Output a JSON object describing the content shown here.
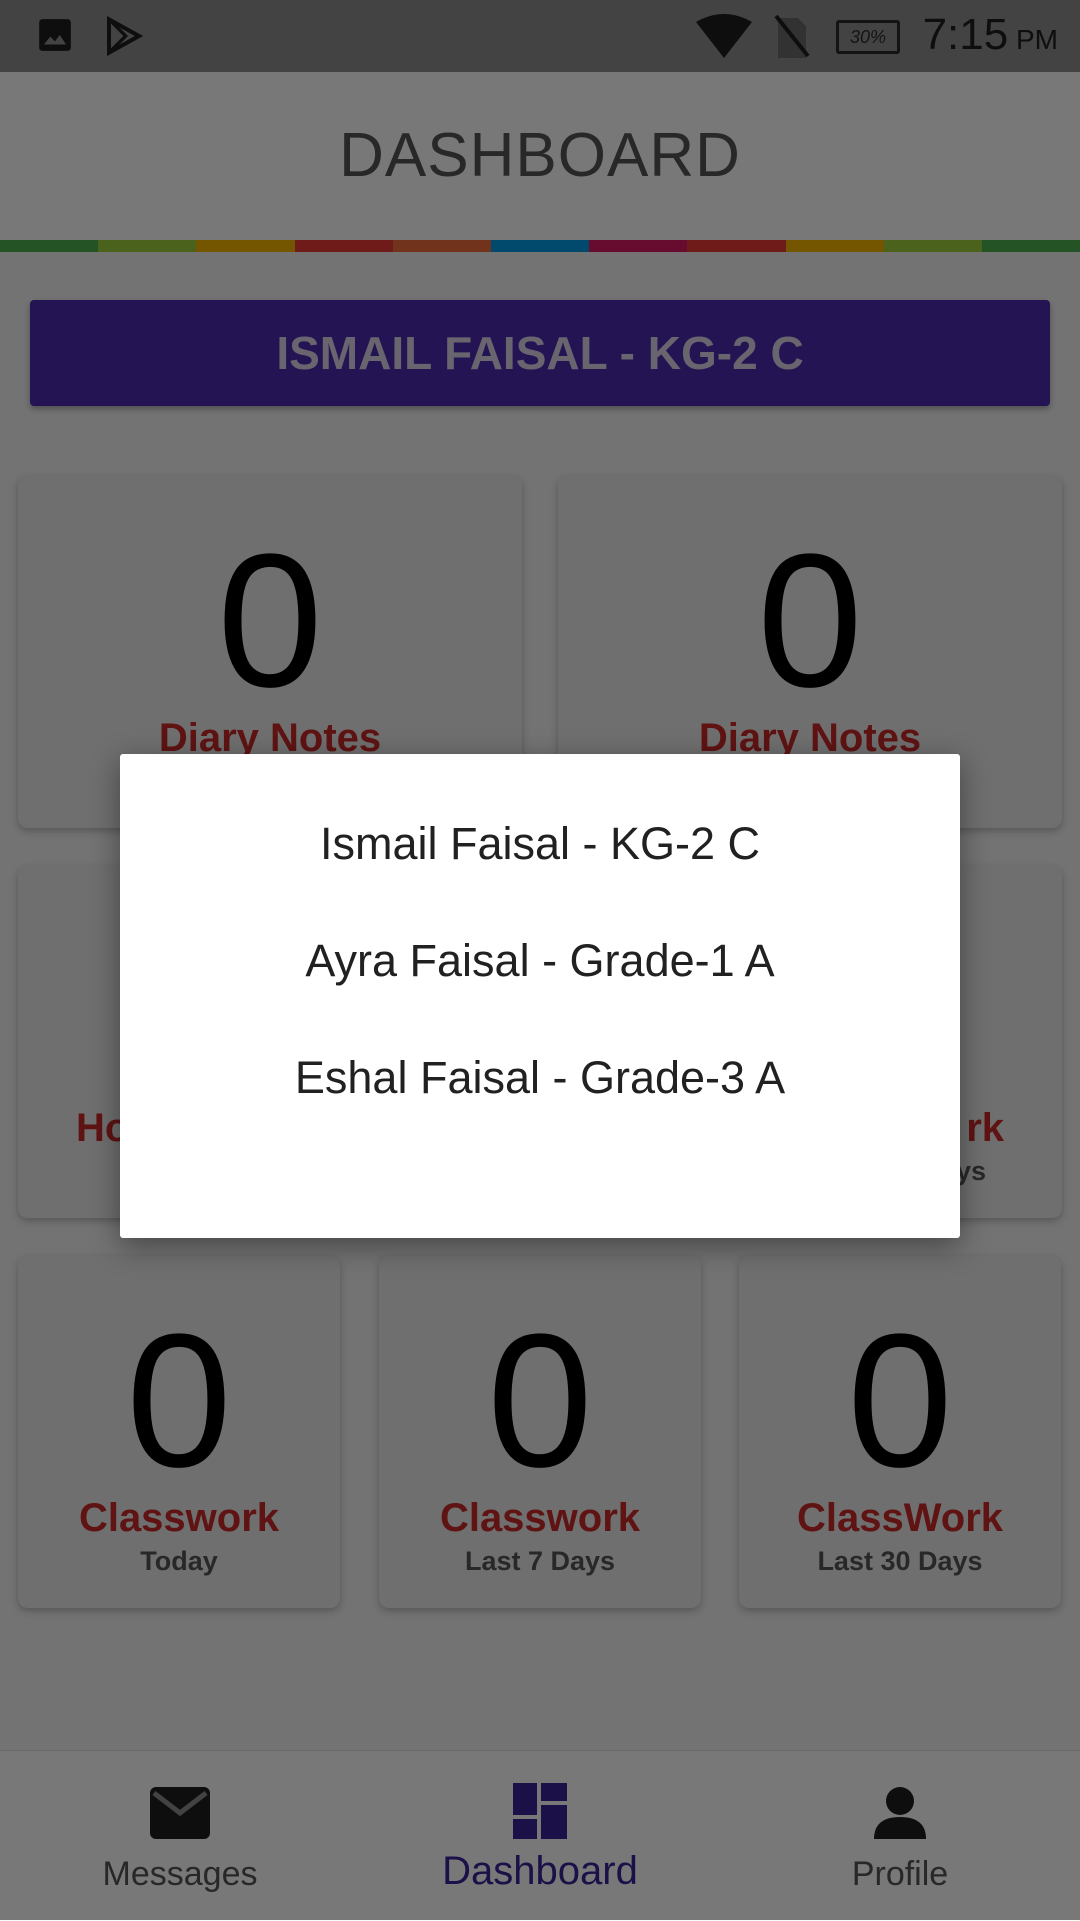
{
  "status_bar": {
    "left_icons": [
      "image-icon",
      "play-store-icon"
    ],
    "right_icons": [
      "wifi-icon",
      "no-sim-icon",
      "battery-icon"
    ],
    "battery": "30%",
    "time": "7:15",
    "ampm": "PM"
  },
  "app_bar": {
    "title": "DASHBOARD"
  },
  "stripe_colors": [
    "#4caf50",
    "#9ccc3c",
    "#f4b400",
    "#e53935",
    "#ef6c3c",
    "#039be5",
    "#d81b60",
    "#e53935",
    "#f4b400",
    "#9ccc3c",
    "#4caf50"
  ],
  "student_selector": {
    "label": "ISMAIL  FAISAL - KG-2 C",
    "color": "#4b2ab0"
  },
  "cards": [
    {
      "value": "0",
      "title": "Diary Notes",
      "subtitle": ""
    },
    {
      "value": "0",
      "title": "Diary Notes",
      "subtitle": ""
    },
    {
      "value": "",
      "title": "Ho",
      "subtitle": ""
    },
    {
      "value": "",
      "title": "rk",
      "subtitle": "ys"
    },
    {
      "value": "0",
      "title": "Classwork",
      "subtitle": "Today"
    },
    {
      "value": "0",
      "title": "Classwork",
      "subtitle": "Last 7 Days"
    },
    {
      "value": "0",
      "title": "ClassWork",
      "subtitle": "Last 30 Days"
    }
  ],
  "bottom_nav": {
    "items": [
      {
        "label": "Messages",
        "icon": "mail-icon",
        "active": false
      },
      {
        "label": "Dashboard",
        "icon": "dashboard-icon",
        "active": true
      },
      {
        "label": "Profile",
        "icon": "person-icon",
        "active": false
      }
    ],
    "active_color": "#3b2397"
  },
  "student_dialog": {
    "options": [
      "Ismail  Faisal - KG-2 C",
      "Ayra  Faisal - Grade-1 A",
      "Eshal  Faisal - Grade-3 A"
    ]
  }
}
